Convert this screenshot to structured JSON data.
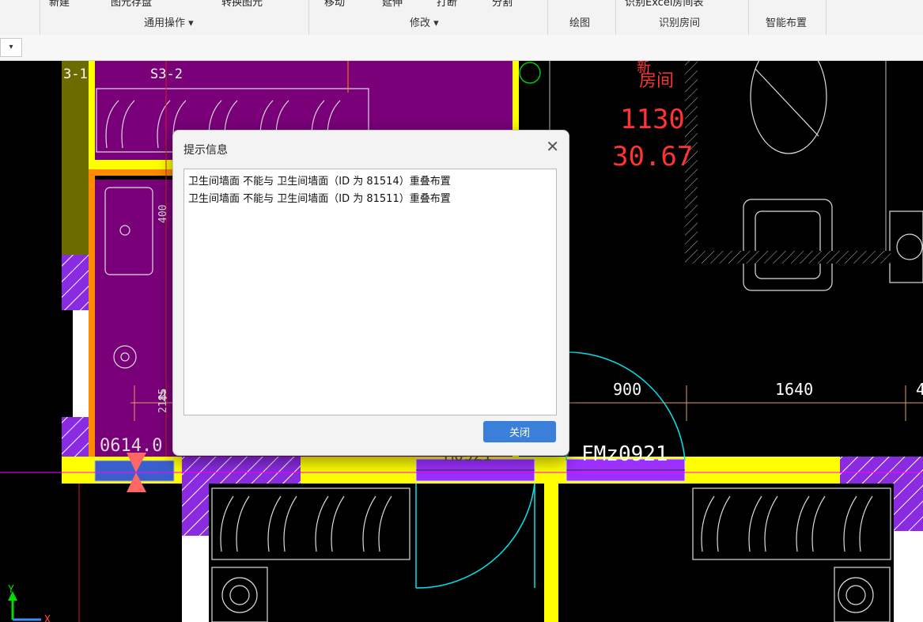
{
  "ribbon": {
    "cut_labels": [
      "新建",
      "图元存盘",
      "转换图元",
      "移动",
      "延伸",
      "打断",
      "分割",
      "识别Excel房间表"
    ],
    "groups": [
      {
        "label": "通用操作 ▾"
      },
      {
        "label": "修改 ▾"
      },
      {
        "label": "绘图"
      },
      {
        "label": "识别房间"
      },
      {
        "label": "智能布置"
      }
    ]
  },
  "toolbar": {
    "combo_caret": "▾"
  },
  "cad": {
    "labels": {
      "a": "3-1",
      "b": "S3-2",
      "room_name_1": "新",
      "room_name_2": "房间",
      "room_code": "1130",
      "room_area": "30.67",
      "dim_900": "900",
      "dim_1640": "1640",
      "dim_4": "4",
      "dim_4_right": "4",
      "door_fm": "FMz0921",
      "door_m": "M0921",
      "win_code": "0614.0",
      "dim_side": "2185",
      "dim_side2": "400",
      "axis_y": "Y",
      "axis_x": "X"
    },
    "colors": {
      "purple": "#7a007a",
      "violet": "#8a2be2",
      "yellow": "#ffff00",
      "orange": "#ff8c00",
      "olive": "#6b6b00",
      "cyan": "#00ffff",
      "red": "#ff3333",
      "white": "#ffffff",
      "magenta": "#ff00ff",
      "green": "#00cc00"
    }
  },
  "dialog": {
    "title": "提示信息",
    "close_glyph": "✕",
    "messages": [
      "卫生间墙面 不能与 卫生间墙面（ID 为 81514）重叠布置",
      "卫生间墙面 不能与 卫生间墙面（ID 为 81511）重叠布置"
    ],
    "close_button": "关闭"
  }
}
